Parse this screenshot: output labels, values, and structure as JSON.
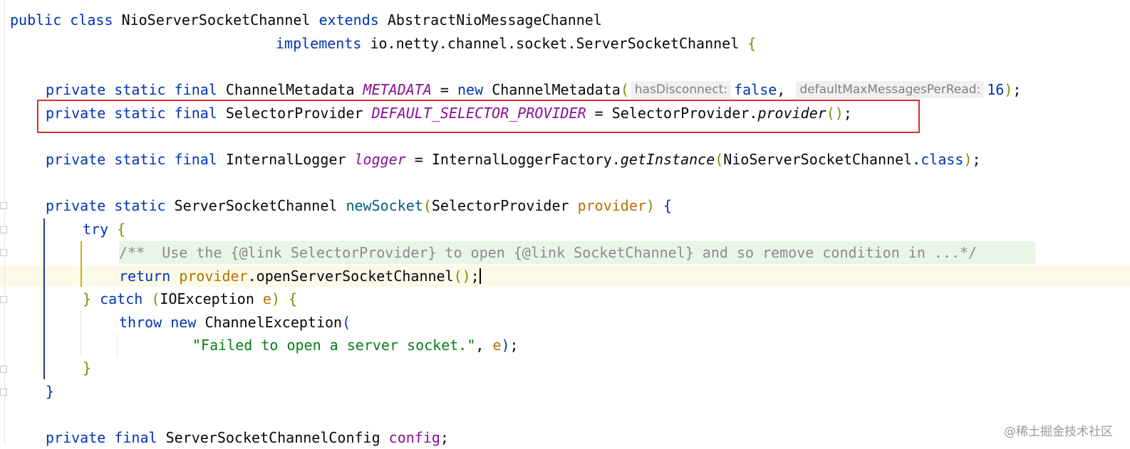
{
  "code": {
    "line1": {
      "kw1": "public",
      "kw2": "class",
      "name": "NioServerSocketChannel",
      "kw3": "extends",
      "parent": "AbstractNioMessageChannel"
    },
    "line2": {
      "kw": "implements",
      "iface": "io.netty.channel.socket.ServerSocketChannel",
      "brace": "{"
    },
    "line3": {
      "mods": "private static final",
      "type": "ChannelMetadata",
      "name": "METADATA",
      "eq": "=",
      "kw_new": "new",
      "ctor": "ChannelMetadata",
      "open": "(",
      "hint1": "hasDisconnect:",
      "arg1": "false",
      "comma": ",",
      "hint2": "defaultMaxMessagesPerRead:",
      "arg2": "16",
      "close": ")",
      "semi": ";"
    },
    "line4": {
      "mods": "private static final",
      "type": "SelectorProvider",
      "name": "DEFAULT_SELECTOR_PROVIDER",
      "eq": "=",
      "cls": "SelectorProvider.",
      "call": "provider",
      "parens": "()",
      "semi": ";"
    },
    "line5": {
      "mods": "private static final",
      "type": "InternalLogger",
      "name": "logger",
      "eq": "=",
      "cls": "InternalLoggerFactory.",
      "call": "getInstance",
      "open": "(",
      "arg": "NioServerSocketChannel.",
      "kw_class": "class",
      "close": ")",
      "semi": ";"
    },
    "line6": {
      "mods": "private static",
      "type": "ServerSocketChannel",
      "method": "newSocket",
      "open": "(",
      "ptype": "SelectorProvider",
      "pname": "provider",
      "close": ")",
      "brace": "{"
    },
    "line7": {
      "kw": "try",
      "brace": "{"
    },
    "line8": {
      "comment": "/**  Use the {@link SelectorProvider} to open {@link SocketChannel} and so remove condition in ...*/"
    },
    "line9": {
      "kw": "return",
      "var": "provider",
      "call": ".openServerSocketChannel",
      "parens": "()",
      "semi": ";"
    },
    "line10": {
      "close": "}",
      "kw": "catch",
      "open": "(",
      "type": "IOException",
      "var": "e",
      "close2": ")",
      "brace": "{"
    },
    "line11": {
      "kw1": "throw",
      "kw2": "new",
      "cls": "ChannelException",
      "open": "("
    },
    "line12": {
      "str": "\"Failed to open a server socket.\"",
      "comma": ",",
      "var": "e",
      "close": ")",
      "semi": ";"
    },
    "line13": {
      "brace": "}"
    },
    "line14": {
      "brace": "}"
    },
    "line15": {
      "mods": "private final",
      "type": "ServerSocketChannelConfig",
      "name": "config",
      "semi": ";"
    }
  },
  "watermark": "@稀土掘金技术社区",
  "colors": {
    "keyword": "#0033b3",
    "constant": "#871094",
    "method": "#00627a",
    "parameter": "#b57000",
    "string": "#067d17",
    "comment": "#8c8c8c",
    "highlight_box": "#d9302c"
  }
}
